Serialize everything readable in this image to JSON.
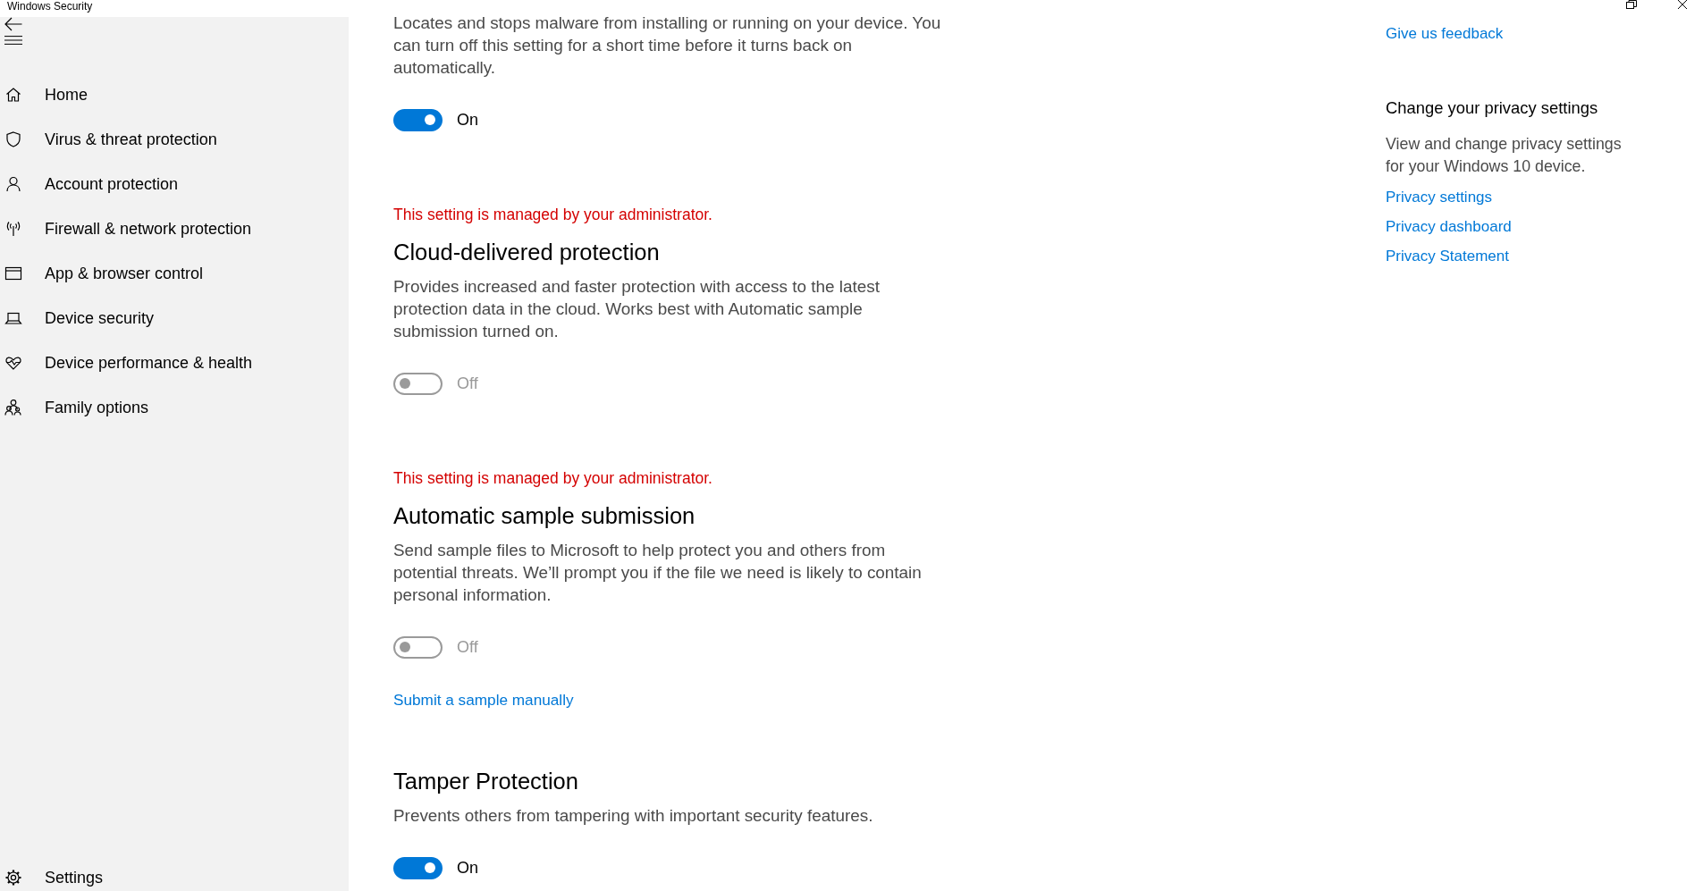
{
  "window": {
    "title": "Windows Security"
  },
  "sidebar": {
    "items": [
      {
        "label": "Home"
      },
      {
        "label": "Virus & threat protection"
      },
      {
        "label": "Account protection"
      },
      {
        "label": "Firewall & network protection"
      },
      {
        "label": "App & browser control"
      },
      {
        "label": "Device security"
      },
      {
        "label": "Device performance & health"
      },
      {
        "label": "Family options"
      }
    ],
    "settings": {
      "label": "Settings"
    }
  },
  "main": {
    "sections": [
      {
        "description": "Locates and stops malware from installing or running on your device. You can turn off this setting for a short time before it turns back on automatically.",
        "toggle": {
          "on": true,
          "disabled": false,
          "label": "On"
        }
      },
      {
        "notice": "This setting is managed by your administrator.",
        "heading": "Cloud-delivered protection",
        "description": "Provides increased and faster protection with access to the latest protection data in the cloud. Works best with Automatic sample submission turned on.",
        "toggle": {
          "on": false,
          "disabled": true,
          "label": "Off"
        }
      },
      {
        "notice": "This setting is managed by your administrator.",
        "heading": "Automatic sample submission",
        "description": "Send sample files to Microsoft to help protect you and others from potential threats. We’ll prompt you if the file we need is likely to contain personal information.",
        "toggle": {
          "on": false,
          "disabled": true,
          "label": "Off"
        },
        "link": "Submit a sample manually"
      },
      {
        "heading": "Tamper Protection",
        "description": "Prevents others from tampering with important security features.",
        "toggle": {
          "on": true,
          "disabled": false,
          "label": "On"
        }
      }
    ]
  },
  "aside": {
    "feedback_link": "Give us feedback",
    "privacy": {
      "heading": "Change your privacy settings",
      "description": "View and change privacy settings for your Windows 10 device.",
      "links": [
        "Privacy settings",
        "Privacy dashboard",
        "Privacy Statement"
      ]
    }
  }
}
